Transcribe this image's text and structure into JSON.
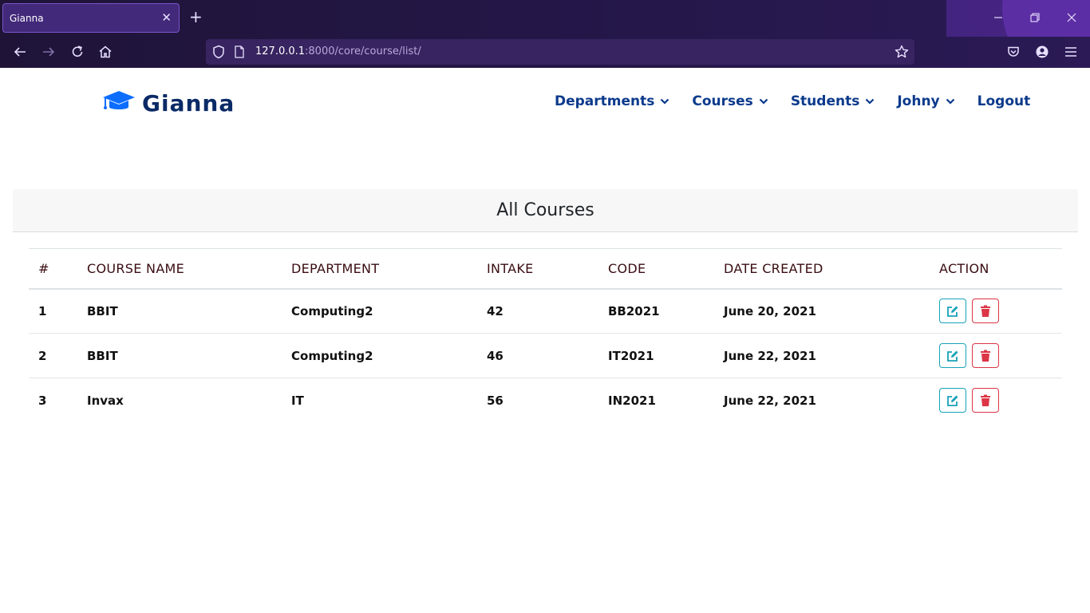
{
  "browser": {
    "tab_title": "Gianna",
    "url_host": "127.0.0.1",
    "url_rest": ":8000/core/course/list/"
  },
  "site": {
    "brand": "Gianna",
    "brand_color": "#0a2a66",
    "icon_color": "#0d6efd",
    "nav": {
      "departments": "Departments",
      "courses": "Courses",
      "students": "Students",
      "user": "Johny",
      "logout": "Logout"
    }
  },
  "courses": {
    "header": "All Courses",
    "columns": [
      "#",
      "COURSE NAME",
      "DEPARTMENT",
      "INTAKE",
      "CODE",
      "DATE CREATED",
      "ACTION"
    ],
    "rows": [
      {
        "num": "1",
        "name": "BBIT",
        "department": "Computing2",
        "intake": "42",
        "code": "BB2021",
        "date": "June 20, 2021"
      },
      {
        "num": "2",
        "name": "BBIT",
        "department": "Computing2",
        "intake": "46",
        "code": "IT2021",
        "date": "June 22, 2021"
      },
      {
        "num": "3",
        "name": "Invax",
        "department": "IT",
        "intake": "56",
        "code": "IN2021",
        "date": "June 22, 2021"
      }
    ],
    "edit_color": "#17a2b8",
    "delete_color": "#dc3545"
  }
}
